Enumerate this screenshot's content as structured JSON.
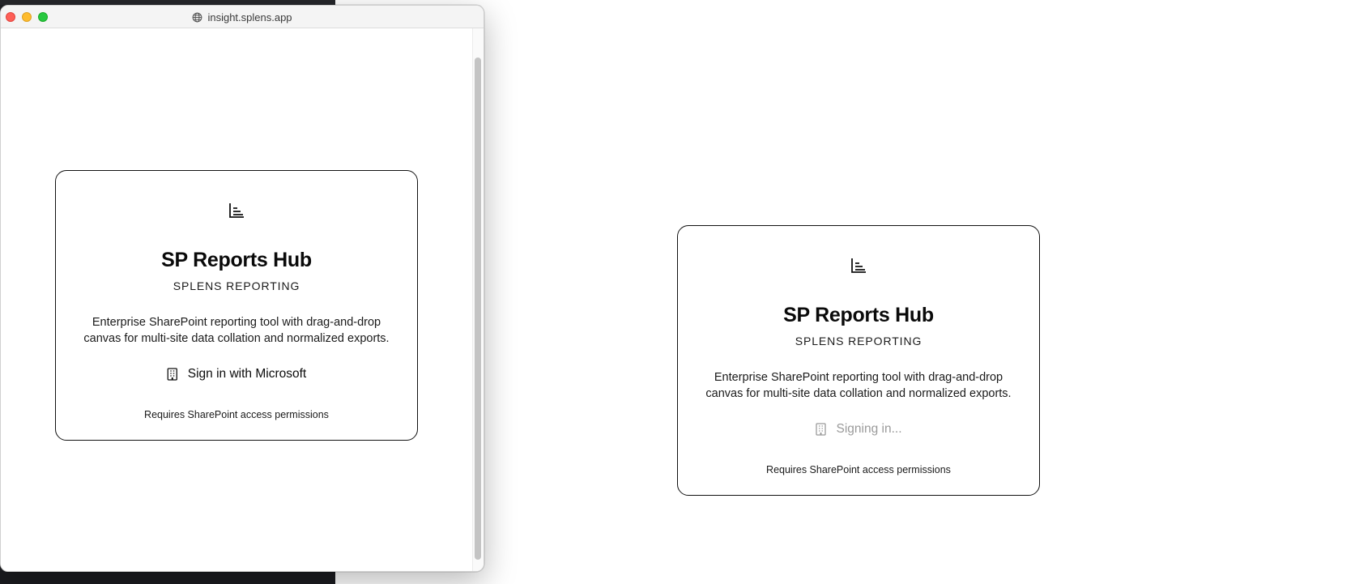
{
  "popup": {
    "url": "insight.splens.app",
    "icons": {
      "globe": "globe-icon"
    }
  },
  "card_left": {
    "icon": "bar-chart-icon",
    "title": "SP Reports Hub",
    "subtitle": "SPLENS REPORTING",
    "description": "Enterprise SharePoint reporting tool with drag-and-drop canvas for multi-site data collation and normalized exports.",
    "button_icon": "building-icon",
    "button_label": "Sign in with Microsoft",
    "note": "Requires SharePoint access permissions"
  },
  "card_right": {
    "icon": "bar-chart-icon",
    "title": "SP Reports Hub",
    "subtitle": "SPLENS REPORTING",
    "description": "Enterprise SharePoint reporting tool with drag-and-drop canvas for multi-site data collation and normalized exports.",
    "button_icon": "building-icon",
    "button_label": "Signing in...",
    "note": "Requires SharePoint access permissions"
  },
  "colors": {
    "border": "#111111",
    "disabled_text": "#9a9a9a",
    "close": "#fe5f57",
    "minimize": "#febc2e",
    "maximize": "#28c840",
    "background_app": "#1f2024"
  }
}
